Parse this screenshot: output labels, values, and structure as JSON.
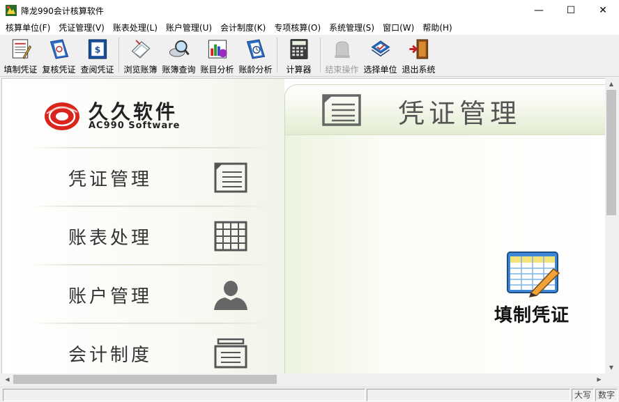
{
  "window": {
    "title": "降龙990会计核算软件",
    "controls": {
      "minimize": "—",
      "maximize": "☐",
      "close": "✕"
    }
  },
  "menu": [
    "核算单位(F)",
    "凭证管理(V)",
    "账表处理(L)",
    "账户管理(U)",
    "会计制度(K)",
    "专项核算(O)",
    "系统管理(S)",
    "窗口(W)",
    "帮助(H)"
  ],
  "toolbar": [
    {
      "label": "填制凭证",
      "icon": "fill-voucher-icon",
      "enabled": true
    },
    {
      "label": "复核凭证",
      "icon": "review-voucher-icon",
      "enabled": true
    },
    {
      "label": "查阅凭证",
      "icon": "view-voucher-icon",
      "enabled": true
    },
    {
      "label": "浏览账簿",
      "icon": "browse-ledger-icon",
      "enabled": true
    },
    {
      "label": "账簿查询",
      "icon": "ledger-query-icon",
      "enabled": true
    },
    {
      "label": "账目分析",
      "icon": "account-analysis-icon",
      "enabled": true
    },
    {
      "label": "账龄分析",
      "icon": "aging-analysis-icon",
      "enabled": true
    },
    {
      "label": "计算器",
      "icon": "calculator-icon",
      "enabled": true
    },
    {
      "label": "结束操作",
      "icon": "end-operation-icon",
      "enabled": false
    },
    {
      "label": "选择单位",
      "icon": "select-unit-icon",
      "enabled": true
    },
    {
      "label": "退出系统",
      "icon": "exit-system-icon",
      "enabled": true
    }
  ],
  "logo": {
    "cn": "久久软件",
    "en": "AC990 Software"
  },
  "nav": [
    {
      "label": "凭证管理",
      "icon": "voucher-list-icon"
    },
    {
      "label": "账表处理",
      "icon": "table-grid-icon"
    },
    {
      "label": "账户管理",
      "icon": "user-icon"
    },
    {
      "label": "会计制度",
      "icon": "document-icon"
    }
  ],
  "panel": {
    "title": "凭证管理",
    "entry_label": "填制凭证"
  },
  "status": {
    "caps": "大写",
    "num": "数字"
  },
  "colors": {
    "logo_red": "#d9251c",
    "panel_green": "#e3ecd0",
    "blue_icon": "#2a6fc7"
  }
}
